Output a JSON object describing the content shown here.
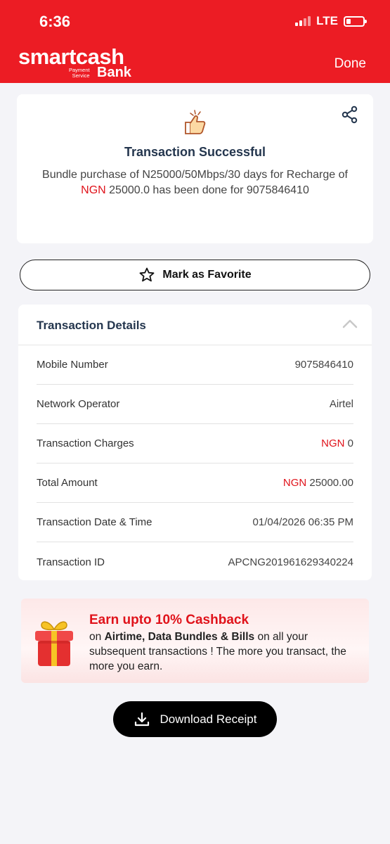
{
  "status_bar": {
    "time": "6:36",
    "network": "LTE"
  },
  "header": {
    "logo_main": "smartcash",
    "logo_sub_line1": "Payment",
    "logo_sub_line2": "Service",
    "logo_bank": "Bank",
    "done_label": "Done"
  },
  "success": {
    "title": "Transaction Successful",
    "desc_part1": "Bundle purchase of N25000/50Mbps/30 days for Recharge of ",
    "desc_currency": "NGN",
    "desc_part2": " 25000.0 has been done for 9075846410"
  },
  "favorite": {
    "label": "Mark as Favorite"
  },
  "details": {
    "title": "Transaction Details",
    "rows": [
      {
        "label": "Mobile Number",
        "currency": "",
        "value": "9075846410"
      },
      {
        "label": "Network Operator",
        "currency": "",
        "value": "Airtel"
      },
      {
        "label": "Transaction Charges",
        "currency": "NGN",
        "value": "0"
      },
      {
        "label": "Total Amount",
        "currency": "NGN",
        "value": "25000.00"
      },
      {
        "label": "Transaction Date & Time",
        "currency": "",
        "value": "01/04/2026 06:35 PM"
      },
      {
        "label": "Transaction ID",
        "currency": "",
        "value": "APCNG201961629340224"
      }
    ]
  },
  "promo": {
    "title": "Earn upto 10% Cashback",
    "text_prefix": "on ",
    "text_bold": "Airtime, Data Bundles & Bills",
    "text_suffix": " on all your subsequent transactions ! The more you transact, the more you earn."
  },
  "download": {
    "label": "Download Receipt"
  },
  "colors": {
    "brand": "#ec1c24",
    "accent_red": "#e0131b",
    "title_navy": "#24364e"
  },
  "icons": [
    "share-icon",
    "thumbs-up-icon",
    "star-icon",
    "chevron-up-icon",
    "gift-icon",
    "download-icon"
  ]
}
